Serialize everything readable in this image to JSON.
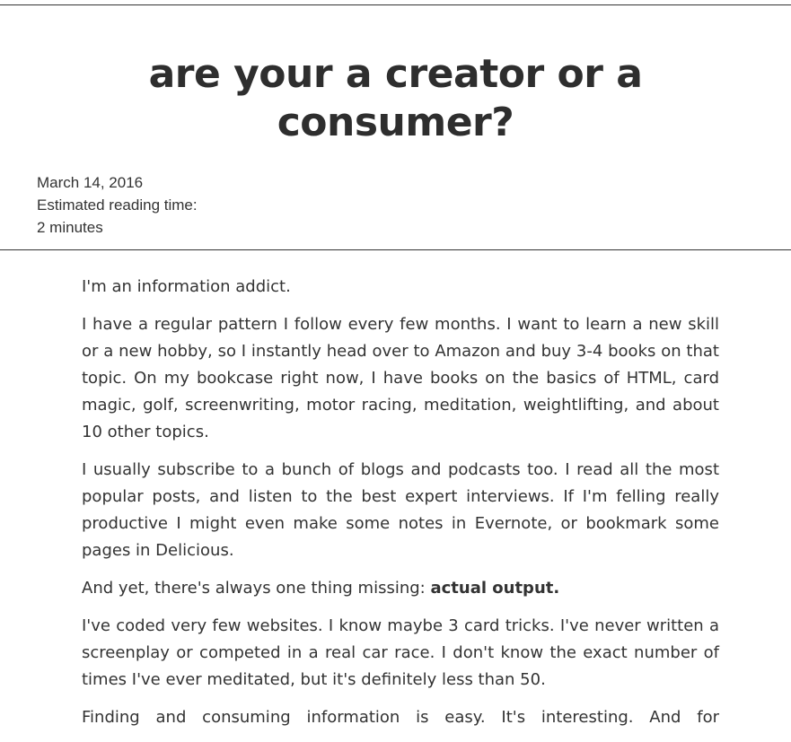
{
  "post": {
    "title_line1": "are your a creator or a",
    "title_line2": "consumer?",
    "date": "March 14, 2016",
    "reading_time_label": "Estimated reading time:",
    "reading_time_value": "2 minutes"
  },
  "body": {
    "p1": "I'm an information addict.",
    "p2": "I have a regular pattern I follow every few months. I want to learn a new skill or a new hobby, so I instantly head over to Amazon and buy 3-4 books on that topic. On my bookcase right now, I have books on the basics of HTML, card magic, golf, screenwriting, motor racing, meditation, weightlifting, and about 10 other topics.",
    "p3": "I usually subscribe to a bunch of blogs and podcasts too. I read all the most popular posts, and listen to the best expert interviews. If I'm felling really productive I might even make some notes in Evernote, or bookmark some pages in Delicious.",
    "p4_text": "And yet, there's always one thing missing: ",
    "p4_bold": "actual output.",
    "p5": "I've coded very few websites. I know maybe 3 card tricks. I've never written a screenplay or competed in a real car race. I don't know the exact number of times I've ever meditated, but it's definitely less than 50.",
    "p6": "Finding and consuming information is easy. It's interesting. And for"
  }
}
